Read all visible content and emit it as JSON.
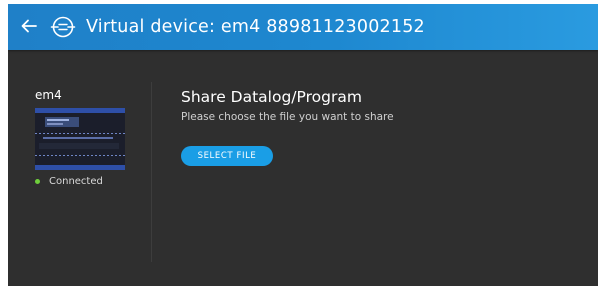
{
  "header": {
    "title": "Virtual device: em4 88981123002152",
    "back_icon": "arrow-left-icon",
    "logo_icon": "connection-logo-icon"
  },
  "sidebar": {
    "device_name": "em4",
    "status_text": "Connected",
    "status_color": "#6fcf3c"
  },
  "main": {
    "title": "Share Datalog/Program",
    "subtitle": "Please choose the file you want to share",
    "select_button_label": "SELECT FILE"
  },
  "colors": {
    "header_bg": "#1e88d0",
    "body_bg": "#2f2f2f",
    "accent_button": "#1a9ee6"
  }
}
